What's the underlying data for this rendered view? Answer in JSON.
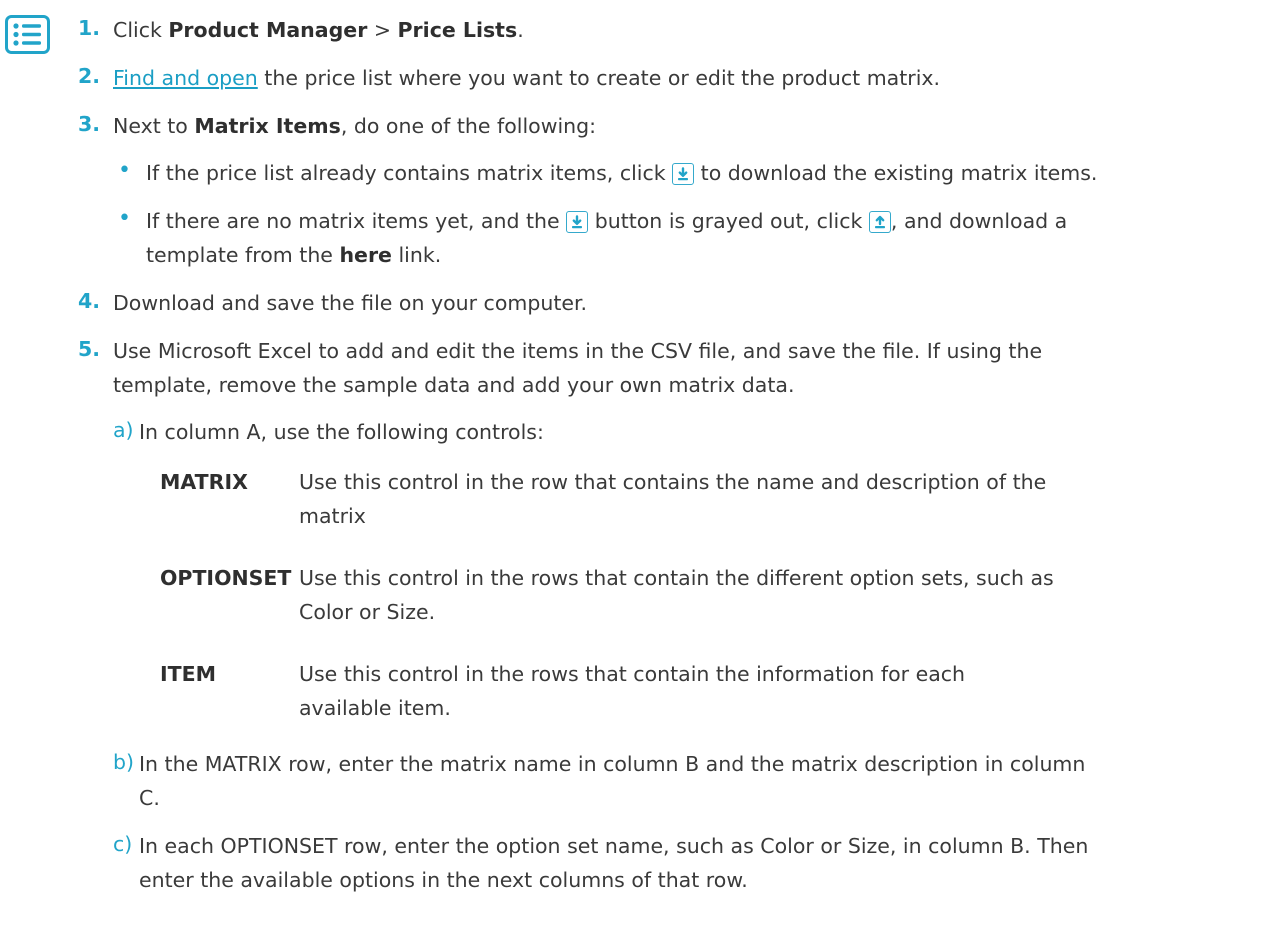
{
  "icon": "task-list-icon",
  "colors": {
    "accent": "#21a4c9",
    "link": "#1a9ec4",
    "text": "#3a3a3a"
  },
  "steps": [
    {
      "num": "1.",
      "t1": "Click ",
      "b1": "Product Manager",
      "t2": " > ",
      "b2": "Price Lists",
      "t3": "."
    },
    {
      "num": "2.",
      "link": "Find and open",
      "t1": " the price list where you want to create or edit the product matrix."
    },
    {
      "num": "3.",
      "t1": "Next to ",
      "b1": "Matrix Items",
      "t2": ", do one of the following:",
      "bullets": [
        {
          "t1": "If the price list already contains matrix items, click ",
          "t2": " to download the existing matrix items."
        },
        {
          "t1": "If there are no matrix items yet, and the ",
          "t2": " button is grayed out, click ",
          "t3": ", and download a",
          "t4": "template from the ",
          "b1": "here",
          "t5": " link."
        }
      ]
    },
    {
      "num": "4.",
      "t1": "Download and save the file on your computer."
    },
    {
      "num": "5.",
      "l1": "Use Microsoft Excel to add and edit the items in the CSV file, and save the file. If using the",
      "l2": "template, remove the sample data and add your own matrix data.",
      "substeps": [
        {
          "letter": "a)",
          "text": "In column A, use the following controls:",
          "controls": [
            {
              "term": "MATRIX",
              "desc": "Use this control in the row that contains the name and description of the matrix"
            },
            {
              "term": "OPTIONSET",
              "desc": "Use this control in the rows that contain the different option sets, such as Color or Size."
            },
            {
              "term": "ITEM",
              "desc": "Use this control in the rows that contain the information for each available item."
            }
          ]
        },
        {
          "letter": "b)",
          "l1": "In the MATRIX row, enter the matrix name in column B and the matrix description in column",
          "l2": "C."
        },
        {
          "letter": "c)",
          "l1": "In each OPTIONSET row, enter the option set name, such as Color or Size, in column B. Then",
          "l2": "enter the available options in the next columns of that row."
        }
      ]
    }
  ]
}
